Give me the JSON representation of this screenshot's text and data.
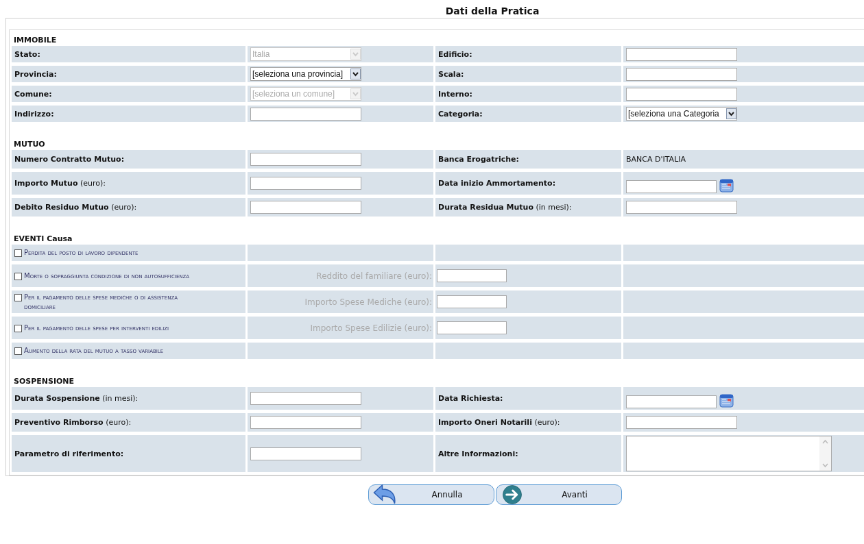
{
  "title": "Dati della Pratica",
  "sections": [
    {
      "title": "IMMOBILE",
      "kind": "fields",
      "rows": [
        {
          "left": {
            "label": "Stato:",
            "control": {
              "kind": "select",
              "value": "Italia",
              "disabled": true
            }
          },
          "right": {
            "label": "Edificio:",
            "control": {
              "kind": "text"
            }
          }
        },
        {
          "left": {
            "label": "Provincia:",
            "control": {
              "kind": "select",
              "value": "[seleziona una provincia]",
              "disabled": false
            }
          },
          "right": {
            "label": "Scala:",
            "control": {
              "kind": "text"
            }
          }
        },
        {
          "left": {
            "label": "Comune:",
            "control": {
              "kind": "select",
              "value": "[seleziona un comune]",
              "disabled": true
            }
          },
          "right": {
            "label": "Interno:",
            "control": {
              "kind": "text"
            }
          }
        },
        {
          "left": {
            "label": "Indirizzo:",
            "control": {
              "kind": "text"
            }
          },
          "right": {
            "label": "Categoria:",
            "control": {
              "kind": "select",
              "value": "[seleziona una Categoria",
              "disabled": false
            }
          }
        }
      ]
    },
    {
      "title": "MUTUO",
      "kind": "fields",
      "rows": [
        {
          "left": {
            "label": "Numero Contratto Mutuo:",
            "control": {
              "kind": "text"
            }
          },
          "right": {
            "label": "Banca Erogatriche:",
            "control": {
              "kind": "static",
              "value": "BANCA D'ITALIA"
            }
          }
        },
        {
          "left": {
            "label": "Importo Mutuo",
            "note": "(euro):",
            "control": {
              "kind": "text"
            }
          },
          "right": {
            "label": "Data inizio Ammortamento:",
            "control": {
              "kind": "date"
            }
          }
        },
        {
          "left": {
            "label": "Debito Residuo Mutuo",
            "note": "(euro):",
            "control": {
              "kind": "text"
            }
          },
          "right": {
            "label": "Durata Residua Mutuo",
            "note": "(in mesi):",
            "control": {
              "kind": "text"
            }
          }
        }
      ]
    },
    {
      "title": "EVENTI Causa",
      "kind": "events",
      "rows": [
        {
          "label": "Perdita del posto di lavoro dipendente",
          "checked": false
        },
        {
          "label": "Morte o sopraggiunta condizione di non autosufficienza",
          "checked": false,
          "amount_label": "Reddito del familiare (euro):"
        },
        {
          "label": "Per il pagamento delle spese mediche o di assistenza domiciliare",
          "checked": false,
          "amount_label": "Importo Spese Mediche (euro):"
        },
        {
          "label": "Per il pagamento delle spese per interventi edilizi",
          "checked": false,
          "amount_label": "Importo Spese Edilizie (euro):"
        },
        {
          "label": "Aumento della rata del mutuo a tasso variabile",
          "checked": false
        }
      ]
    },
    {
      "title": "SOSPENSIONE",
      "kind": "fields",
      "rows": [
        {
          "left": {
            "label": "Durata Sospensione",
            "note": "(in mesi):",
            "control": {
              "kind": "text"
            }
          },
          "right": {
            "label": "Data Richiesta:",
            "control": {
              "kind": "date"
            }
          }
        },
        {
          "left": {
            "label": "Preventivo Rimborso",
            "note": "(euro):",
            "control": {
              "kind": "text"
            }
          },
          "right": {
            "label": "Importo Oneri Notarili",
            "note": "(euro):",
            "control": {
              "kind": "text"
            }
          }
        },
        {
          "left": {
            "label": "Parametro di riferimento:",
            "control": {
              "kind": "text"
            }
          },
          "right": {
            "label": "Altre Informazioni:",
            "control": {
              "kind": "textarea"
            }
          }
        }
      ]
    }
  ],
  "buttons": [
    {
      "label": "Annulla",
      "kind": "back"
    },
    {
      "label": "Avanti",
      "kind": "forward"
    }
  ]
}
